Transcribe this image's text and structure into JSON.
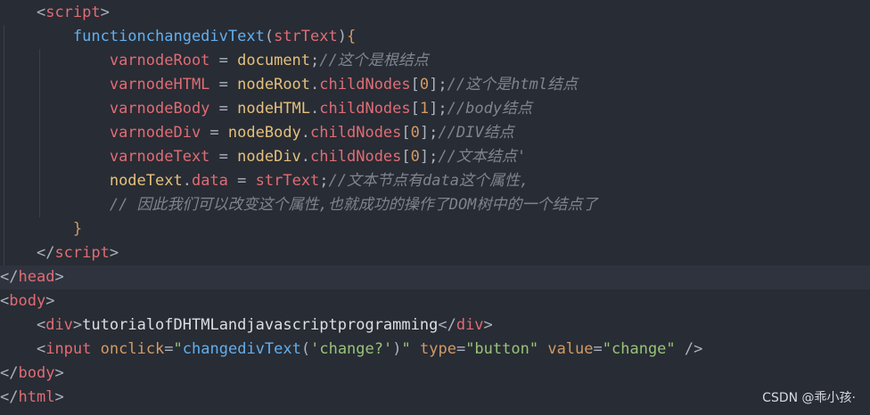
{
  "editor": {
    "lines": [
      {
        "indent": "    ",
        "tokens": [
          [
            "<",
            "punc"
          ],
          [
            "script",
            "tag"
          ],
          [
            ">",
            "punc"
          ]
        ]
      },
      {
        "indent": "        ",
        "tokens": [
          [
            "functionchangedivText",
            "fn"
          ],
          [
            "(",
            "punc"
          ],
          [
            "strText",
            "var"
          ],
          [
            ")",
            "punc"
          ],
          [
            "{",
            "brace"
          ]
        ]
      },
      {
        "indent": "            ",
        "tokens": [
          [
            "varnodeRoot",
            "var"
          ],
          [
            " = ",
            "punc"
          ],
          [
            "document",
            "kw"
          ],
          [
            ";",
            "punc"
          ],
          [
            "//这个是根结点",
            "cmt"
          ]
        ]
      },
      {
        "indent": "            ",
        "tokens": [
          [
            "varnodeHTML",
            "var"
          ],
          [
            " = ",
            "punc"
          ],
          [
            "nodeRoot",
            "kw"
          ],
          [
            ".",
            "punc"
          ],
          [
            "childNodes",
            "prop"
          ],
          [
            "[",
            "punc"
          ],
          [
            "0",
            "num"
          ],
          [
            "]",
            "punc"
          ],
          [
            ";",
            "punc"
          ],
          [
            "//这个是html结点",
            "cmt"
          ]
        ]
      },
      {
        "indent": "            ",
        "tokens": [
          [
            "varnodeBody",
            "var"
          ],
          [
            " = ",
            "punc"
          ],
          [
            "nodeHTML",
            "kw"
          ],
          [
            ".",
            "punc"
          ],
          [
            "childNodes",
            "prop"
          ],
          [
            "[",
            "punc"
          ],
          [
            "1",
            "num"
          ],
          [
            "]",
            "punc"
          ],
          [
            ";",
            "punc"
          ],
          [
            "//body结点",
            "cmt"
          ]
        ]
      },
      {
        "indent": "            ",
        "tokens": [
          [
            "varnodeDiv",
            "var"
          ],
          [
            " = ",
            "punc"
          ],
          [
            "nodeBody",
            "kw"
          ],
          [
            ".",
            "punc"
          ],
          [
            "childNodes",
            "prop"
          ],
          [
            "[",
            "punc"
          ],
          [
            "0",
            "num"
          ],
          [
            "]",
            "punc"
          ],
          [
            ";",
            "punc"
          ],
          [
            "//DIV结点",
            "cmt"
          ]
        ]
      },
      {
        "indent": "            ",
        "tokens": [
          [
            "varnodeText",
            "var"
          ],
          [
            " = ",
            "punc"
          ],
          [
            "nodeDiv",
            "kw"
          ],
          [
            ".",
            "punc"
          ],
          [
            "childNodes",
            "prop"
          ],
          [
            "[",
            "punc"
          ],
          [
            "0",
            "num"
          ],
          [
            "]",
            "punc"
          ],
          [
            ";",
            "punc"
          ],
          [
            "//文本结点'",
            "cmt"
          ]
        ]
      },
      {
        "indent": "            ",
        "tokens": [
          [
            "nodeText",
            "kw"
          ],
          [
            ".",
            "punc"
          ],
          [
            "data",
            "prop"
          ],
          [
            " = ",
            "punc"
          ],
          [
            "strText",
            "var"
          ],
          [
            ";",
            "punc"
          ],
          [
            "//文本节点有data这个属性,",
            "cmt"
          ]
        ]
      },
      {
        "indent": "            ",
        "tokens": [
          [
            "// 因此我们可以改变这个属性,也就成功的操作了DOM树中的一个结点了",
            "cmt"
          ]
        ]
      },
      {
        "indent": "        ",
        "tokens": [
          [
            "}",
            "brace"
          ]
        ]
      },
      {
        "indent": "    ",
        "tokens": [
          [
            "</",
            "punc"
          ],
          [
            "script",
            "tag"
          ],
          [
            ">",
            "punc"
          ]
        ]
      },
      {
        "indent": "",
        "highlight": true,
        "tokens": [
          [
            "</",
            "punc"
          ],
          [
            "head",
            "tag"
          ],
          [
            ">",
            "punc"
          ]
        ]
      },
      {
        "indent": "",
        "tokens": [
          [
            "<",
            "punc"
          ],
          [
            "body",
            "tag"
          ],
          [
            ">",
            "punc"
          ]
        ]
      },
      {
        "indent": "    ",
        "tokens": [
          [
            "<",
            "punc"
          ],
          [
            "div",
            "tag"
          ],
          [
            ">",
            "punc"
          ],
          [
            "tutorialofDHTMLandjavascriptprogramming",
            "text"
          ],
          [
            "</",
            "punc"
          ],
          [
            "div",
            "tag"
          ],
          [
            ">",
            "punc"
          ]
        ]
      },
      {
        "indent": "    ",
        "tokens": [
          [
            "<",
            "punc"
          ],
          [
            "input",
            "tag"
          ],
          [
            " ",
            "punc"
          ],
          [
            "onclick",
            "attr"
          ],
          [
            "=",
            "punc"
          ],
          [
            "\"",
            "str"
          ],
          [
            "changedivText",
            "fn"
          ],
          [
            "(",
            "punc"
          ],
          [
            "'change?'",
            "str"
          ],
          [
            ")",
            "punc"
          ],
          [
            "\"",
            "str"
          ],
          [
            " ",
            "punc"
          ],
          [
            "type",
            "attr"
          ],
          [
            "=",
            "punc"
          ],
          [
            "\"button\"",
            "str"
          ],
          [
            " ",
            "punc"
          ],
          [
            "value",
            "attr"
          ],
          [
            "=",
            "punc"
          ],
          [
            "\"change\"",
            "str"
          ],
          [
            " />",
            "punc"
          ]
        ]
      },
      {
        "indent": "",
        "tokens": [
          [
            "</",
            "punc"
          ],
          [
            "body",
            "tag"
          ],
          [
            ">",
            "punc"
          ]
        ]
      },
      {
        "indent": "",
        "tokens": [
          [
            "</",
            "punc"
          ],
          [
            "html",
            "tag"
          ],
          [
            ">",
            "punc"
          ]
        ]
      }
    ]
  },
  "watermark": "CSDN @乖小孩·"
}
